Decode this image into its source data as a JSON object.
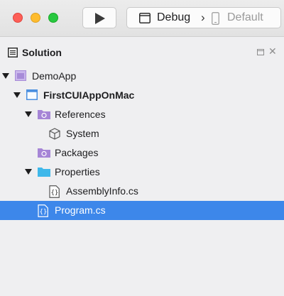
{
  "toolbar": {
    "run_icon": "play-icon",
    "configuration": "Debug",
    "separator": "›",
    "device": "Default"
  },
  "pad": {
    "title": "Solution",
    "close_glyph": "✕"
  },
  "tree": {
    "items": [
      {
        "label": "DemoApp",
        "icon": "solution-icon",
        "expanded": true
      },
      {
        "label": "FirstCUIAppOnMac",
        "icon": "project-icon",
        "expanded": true,
        "bold": true
      },
      {
        "label": "References",
        "icon": "references-folder-icon",
        "expanded": true
      },
      {
        "label": "System",
        "icon": "assembly-reference-icon"
      },
      {
        "label": "Packages",
        "icon": "packages-folder-icon"
      },
      {
        "label": "Properties",
        "icon": "folder-icon",
        "expanded": true
      },
      {
        "label": "AssemblyInfo.cs",
        "icon": "csharp-file-icon"
      },
      {
        "label": "Program.cs",
        "icon": "csharp-file-icon",
        "selected": true
      }
    ]
  },
  "colors": {
    "selection": "#3d87ea",
    "folder_blue": "#3fb8ea",
    "references_purple": "#a685d6",
    "project_blue": "#4a8fe0",
    "solution_purple": "#a78bd8"
  }
}
